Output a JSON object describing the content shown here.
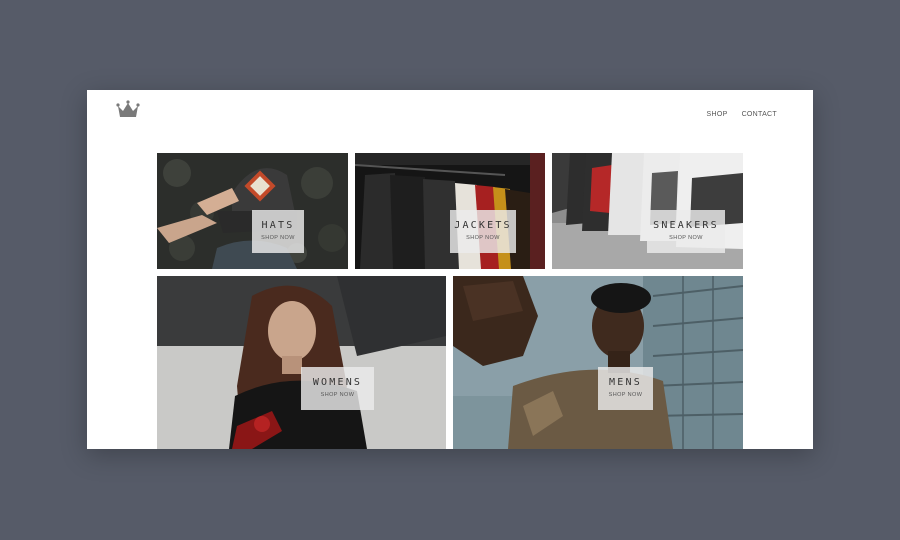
{
  "nav": {
    "shop": "SHOP",
    "contact": "CONTACT"
  },
  "categories": {
    "hats": {
      "title": "HATS",
      "cta": "SHOP NOW"
    },
    "jackets": {
      "title": "JACKETS",
      "cta": "SHOP NOW"
    },
    "sneakers": {
      "title": "SNEAKERS",
      "cta": "SHOP NOW"
    },
    "womens": {
      "title": "WOMENS",
      "cta": "SHOP NOW"
    },
    "mens": {
      "title": "MENS",
      "cta": "SHOP NOW"
    }
  },
  "icons": {
    "logo": "crown-icon"
  }
}
